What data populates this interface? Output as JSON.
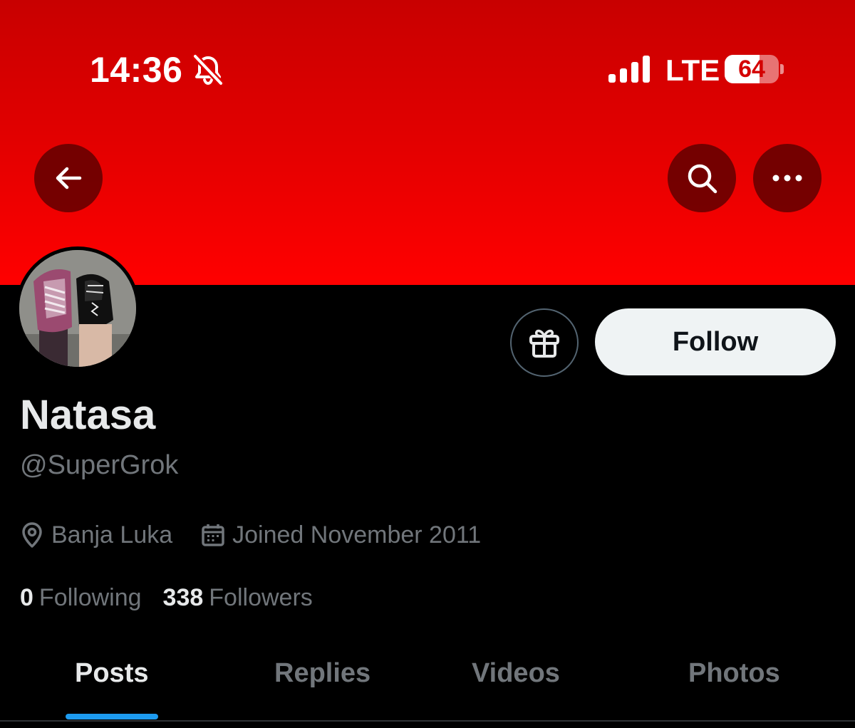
{
  "status_bar": {
    "time": "14:36",
    "silent_icon": "bell-slash-icon",
    "signal_icon": "cellular-signal-icon",
    "network": "LTE",
    "battery_level": "64",
    "battery_fraction": 0.64
  },
  "header": {
    "back_icon": "arrow-left-icon",
    "search_icon": "search-icon",
    "more_icon": "more-horizontal-icon",
    "banner_color": "#ff0000"
  },
  "profile": {
    "name": "Natasa",
    "handle": "@SuperGrok",
    "location": "Banja Luka",
    "joined": "Joined November 2011",
    "following_count": "0",
    "following_label": "Following",
    "followers_count": "338",
    "followers_label": "Followers"
  },
  "actions": {
    "gift_icon": "gift-icon",
    "follow_label": "Follow"
  },
  "tabs": [
    {
      "label": "Posts",
      "active": true
    },
    {
      "label": "Replies",
      "active": false
    },
    {
      "label": "Videos",
      "active": false
    },
    {
      "label": "Photos",
      "active": false
    }
  ],
  "colors": {
    "accent": "#1d9bf0",
    "muted_text": "#71767b",
    "primary_text": "#e7e9ea"
  }
}
